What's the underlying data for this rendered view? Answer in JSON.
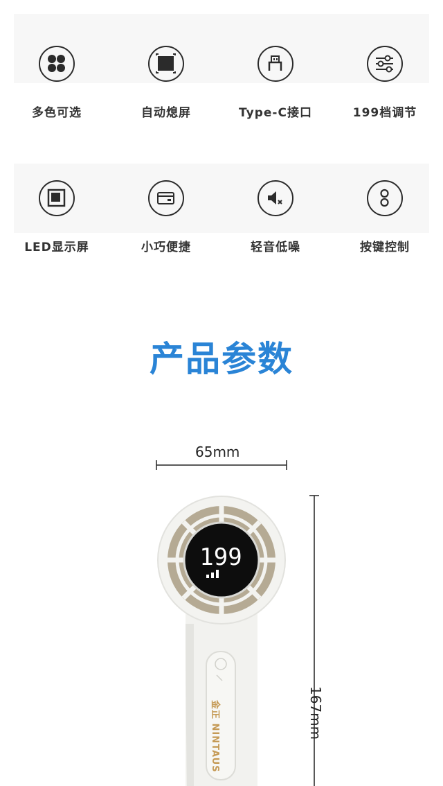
{
  "features": [
    {
      "label": "多色可选",
      "icon": "color-options-icon"
    },
    {
      "label": "自动熄屏",
      "icon": "screen-off-icon"
    },
    {
      "label": "Type-C接口",
      "icon": "usb-c-icon"
    },
    {
      "label": "199档调节",
      "icon": "sliders-icon"
    },
    {
      "label": "LED显示屏",
      "icon": "led-display-icon"
    },
    {
      "label": "小巧便捷",
      "icon": "wallet-icon"
    },
    {
      "label": "轻音低噪",
      "icon": "mute-speaker-icon"
    },
    {
      "label": "按键控制",
      "icon": "button-control-icon"
    }
  ],
  "section_title": "产品参数",
  "dimensions": {
    "width": "65mm",
    "height": "167mm"
  },
  "product": {
    "display_value": "199",
    "brand": "金正 NINTAUS"
  },
  "colors": {
    "accent": "#2a84d6",
    "brand": "#c59a55",
    "icon": "#2b2b2b"
  }
}
